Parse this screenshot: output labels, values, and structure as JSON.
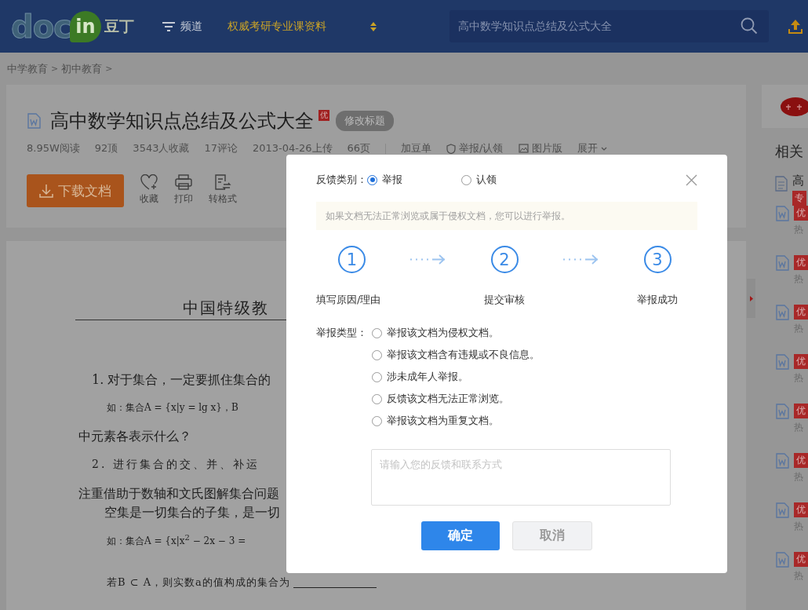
{
  "header": {
    "logo": {
      "word": "doc",
      "badge": "in",
      "name": "豆丁"
    },
    "channel": "频道",
    "promo": "权威考研专业课资料",
    "search": {
      "value": "高中数学知识点总结及公式大全"
    }
  },
  "breadcrumb": {
    "separator": ">",
    "items": [
      "中学教育",
      "初中教育"
    ]
  },
  "document": {
    "title": "高中数学知识点总结及公式大全",
    "badge": "优",
    "edit_button": "修改标题",
    "stats": [
      "8.95W阅读",
      "92顶",
      "3543人收藏",
      "17评论",
      "2013-04-26上传",
      "66页"
    ],
    "actions": [
      {
        "label": "加豆单",
        "kind": "list"
      },
      {
        "label": "举报/认领",
        "kind": "report"
      },
      {
        "label": "图片版",
        "kind": "picture-view"
      },
      {
        "label": "展开",
        "kind": "expand"
      }
    ],
    "download": "下载文档",
    "tools": [
      {
        "label": "收藏",
        "kind": "favorite"
      },
      {
        "label": "打印",
        "kind": "print"
      },
      {
        "label": "转格式",
        "kind": "convert"
      }
    ]
  },
  "page_lines": [
    {
      "kind": "heading",
      "text": "中国特级教"
    },
    {
      "kind": "para",
      "text": "1. 对于集合，一定要抓住集合的"
    },
    {
      "kind": "formula",
      "text": "如：集合A = {x|y = lg x}，B"
    },
    {
      "kind": "plain",
      "text": "中元素各表示什么？"
    },
    {
      "kind": "spaced",
      "text": "2. 进行集合的交、并、补运"
    },
    {
      "kind": "plain",
      "text": "注重借助于数轴和文氏图解集合问题"
    },
    {
      "kind": "indent",
      "text": "空集是一切集合的子集，是一切"
    },
    {
      "kind": "formula",
      "text": "如：集合A = {x|x$^{2}$ − 2x − 3 ="
    },
    {
      "kind": "fill",
      "text": "若B ⊂ A，则实数a的值构成的集合为"
    }
  ],
  "related": {
    "heading": "相关",
    "items": [
      {
        "kind": "featured",
        "title": "高",
        "badge": "专"
      },
      {
        "kind": "doc",
        "badge": "优",
        "hint": "热"
      },
      {
        "kind": "doc",
        "badge": "优",
        "hint": "热"
      },
      {
        "kind": "doc",
        "badge": "优",
        "hint": "热"
      },
      {
        "kind": "doc",
        "badge": "优",
        "hint": "热"
      },
      {
        "kind": "doc",
        "badge": "优",
        "hint": "热"
      },
      {
        "kind": "doc",
        "badge": "优",
        "hint": "热"
      },
      {
        "kind": "doc",
        "badge": "优",
        "hint": "热"
      },
      {
        "kind": "doc",
        "badge": "优",
        "hint": "热"
      }
    ]
  },
  "dialog": {
    "category_label": "反馈类别：",
    "categories": [
      {
        "label": "举报",
        "selected": true
      },
      {
        "label": "认领",
        "selected": false
      }
    ],
    "notice": "如果文档无法正常浏览或属于侵权文档，您可以进行举报。",
    "steps": [
      {
        "number": "1",
        "label": "填写原因/理由"
      },
      {
        "number": "2",
        "label": "提交审核"
      },
      {
        "number": "3",
        "label": "举报成功"
      }
    ],
    "type_label": "举报类型：",
    "types": [
      {
        "label": "举报该文档为侵权文档。",
        "selected": false
      },
      {
        "label": "举报该文档含有违规或不良信息。",
        "selected": false
      },
      {
        "label": "涉未成年人举报。",
        "selected": false
      },
      {
        "label": "反馈该文档无法正常浏览。",
        "selected": false
      },
      {
        "label": "举报该文档为重复文档。",
        "selected": false
      }
    ],
    "feedback": {
      "placeholder": "请输入您的反馈和联系方式"
    },
    "buttons": [
      {
        "label": "确定",
        "kind": "primary"
      },
      {
        "label": "取消",
        "kind": "secondary"
      }
    ]
  }
}
